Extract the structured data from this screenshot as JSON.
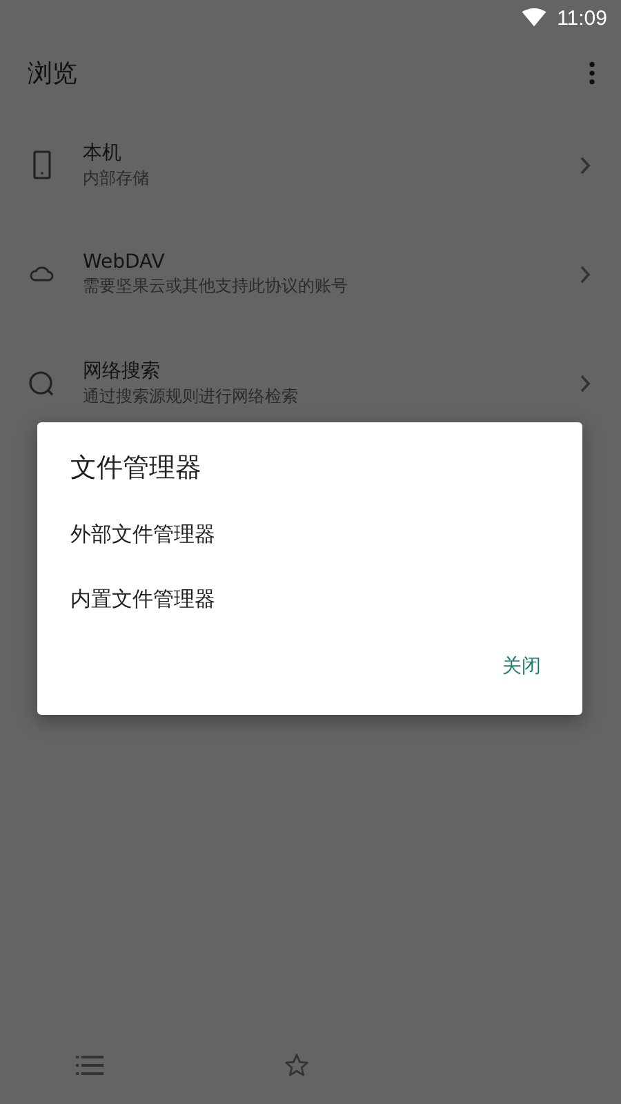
{
  "status_bar": {
    "time": "11:09"
  },
  "toolbar": {
    "title": "浏览"
  },
  "sources": [
    {
      "kind": "phone",
      "title": "本机",
      "subtitle": "内部存储"
    },
    {
      "kind": "cloud",
      "title": "WebDAV",
      "subtitle": "需要坚果云或其他支持此协议的账号"
    },
    {
      "kind": "search",
      "title": "网络搜索",
      "subtitle": "通过搜索源规则进行网络检索"
    }
  ],
  "dialog": {
    "title": "文件管理器",
    "options": [
      "外部文件管理器",
      "内置文件管理器"
    ],
    "button": "关闭"
  },
  "bottom_nav": [
    {
      "kind": "list"
    },
    {
      "kind": "star"
    }
  ]
}
